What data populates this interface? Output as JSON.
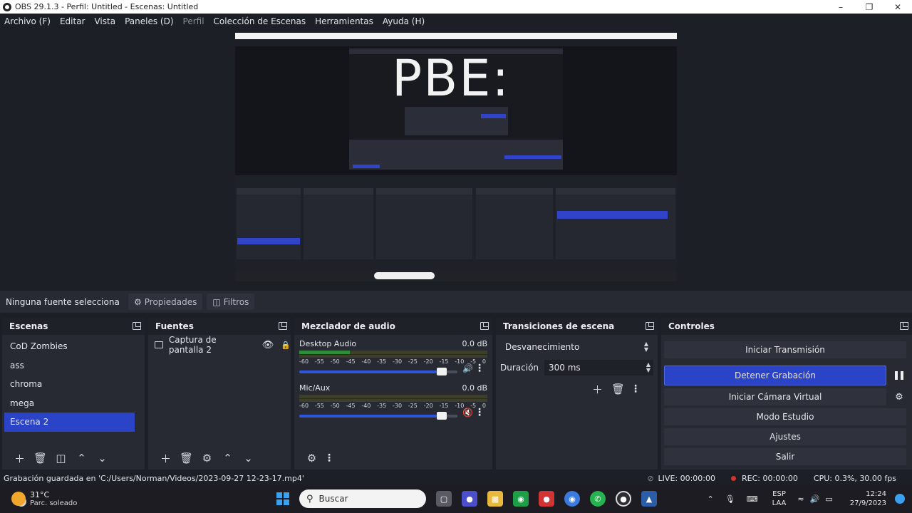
{
  "window": {
    "title": "OBS 29.1.3 - Perfil: Untitled - Escenas: Untitled"
  },
  "menu": [
    "Archivo (F)",
    "Editar",
    "Vista",
    "Paneles (D)",
    "Perfil",
    "Colección de Escenas",
    "Herramientas",
    "Ayuda (H)"
  ],
  "preview": {
    "overlay_text": "PBE:"
  },
  "sourcebar": {
    "no_source": "Ninguna fuente selecciona",
    "properties": "Propiedades",
    "filters": "Filtros"
  },
  "scenes": {
    "title": "Escenas",
    "items": [
      "CoD Zombies",
      "ass",
      "chroma",
      "mega",
      "Escena 2"
    ]
  },
  "sources": {
    "title": "Fuentes",
    "items": [
      "Captura de pantalla 2"
    ]
  },
  "mixer": {
    "title": "Mezclador de audio",
    "scale": [
      "-60",
      "-55",
      "-50",
      "-45",
      "-40",
      "-35",
      "-30",
      "-25",
      "-20",
      "-15",
      "-10",
      "-5",
      "0"
    ],
    "channels": [
      {
        "name": "Desktop Audio",
        "db": "0.0 dB",
        "level": 0.27,
        "volume": 0.93,
        "muted": false
      },
      {
        "name": "Mic/Aux",
        "db": "0.0 dB",
        "level": 0.0,
        "volume": 0.93,
        "muted": true
      }
    ]
  },
  "transitions": {
    "title": "Transiciones de escena",
    "selected": "Desvanecimiento",
    "duration_label": "Duración",
    "duration_value": "300 ms"
  },
  "controls": {
    "title": "Controles",
    "start_stream": "Iniciar Transmisión",
    "stop_recording": "Detener Grabación",
    "virtual_cam": "Iniciar Cámara Virtual",
    "studio_mode": "Modo Estudio",
    "settings": "Ajustes",
    "exit": "Salir"
  },
  "status": {
    "message": "Grabación guardada en 'C:/Users/Norman/Videos/2023-09-27 12-23-17.mp4'",
    "live": "LIVE: 00:00:00",
    "rec": "REC: 00:00:00",
    "cpu": "CPU: 0.3%, 30.00 fps"
  },
  "taskbar": {
    "temp": "31°C",
    "weather": "Parc. soleado",
    "search": "Buscar",
    "lang1": "ESP",
    "lang2": "LAA",
    "time": "12:24",
    "date": "27/9/2023"
  },
  "colors": {
    "accent": "#2b43c6",
    "panel": "#272a33",
    "background": "#1d1f26",
    "record": "#d13434"
  }
}
